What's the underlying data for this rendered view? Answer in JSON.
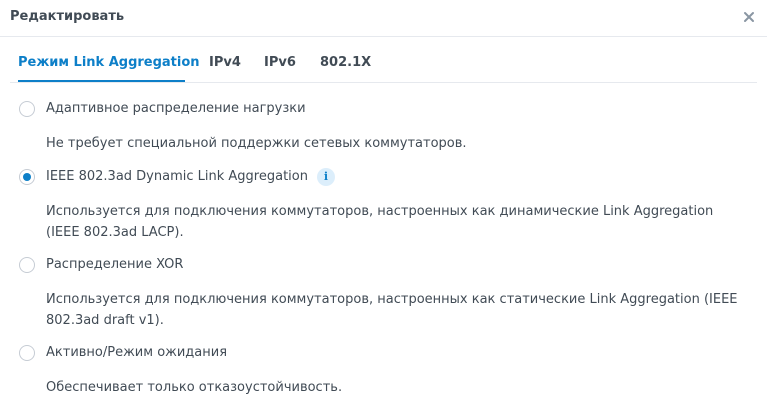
{
  "dialog": {
    "title": "Редактировать"
  },
  "tabs": [
    {
      "label": "Режим Link Aggregation",
      "active": true
    },
    {
      "label": "IPv4",
      "active": false
    },
    {
      "label": "IPv6",
      "active": false
    },
    {
      "label": "802.1X",
      "active": false
    }
  ],
  "options": [
    {
      "label": "Адаптивное распределение нагрузки",
      "description": "Не требует специальной поддержки сетевых коммутаторов.",
      "selected": false
    },
    {
      "label": "IEEE 802.3ad Dynamic Link Aggregation",
      "description": "Используется для подключения коммутаторов, настроенных как динамические Link Aggregation (IEEE 802.3ad LACP).",
      "selected": true,
      "has_info_icon": true
    },
    {
      "label": "Распределение XOR",
      "description": "Используется для подключения коммутаторов, настроенных как статические Link Aggregation (IEEE 802.3ad draft v1).",
      "selected": false
    },
    {
      "label": "Активно/Режим ожидания",
      "description": "Обеспечивает только отказоустойчивость.",
      "selected": false
    }
  ],
  "icons": {
    "close": "close-icon",
    "info": "info-icon",
    "info_glyph": "i"
  },
  "colors": {
    "accent": "#0d7fc8",
    "text": "#414b55",
    "border": "#e6e9ee",
    "info_bg": "#dceefb"
  }
}
